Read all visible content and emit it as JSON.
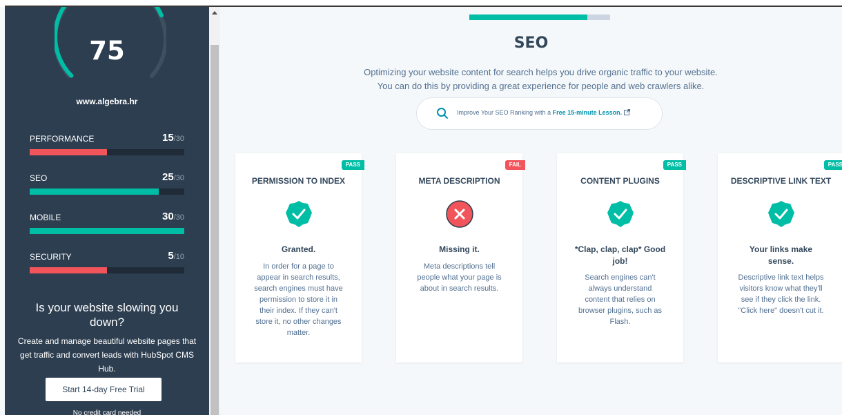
{
  "overall": {
    "score": "75",
    "site": "www.algebra.hr",
    "fraction": 0.75
  },
  "metrics": [
    {
      "label": "PERFORMANCE",
      "score": "15",
      "max": "/30",
      "fraction": 0.5,
      "color": "#f2545b"
    },
    {
      "label": "SEO",
      "score": "25",
      "max": "/30",
      "fraction": 0.833,
      "color": "#00bda5"
    },
    {
      "label": "MOBILE",
      "score": "30",
      "max": "/30",
      "fraction": 1.0,
      "color": "#00bda5"
    },
    {
      "label": "SECURITY",
      "score": "5",
      "max": "/10",
      "fraction": 0.5,
      "color": "#f2545b"
    }
  ],
  "promo": {
    "title": "Is your website slowing you down?",
    "text": "Create and manage beautiful website pages that get traffic and convert leads with HubSpot CMS Hub.",
    "button": "Start 14-day Free Trial",
    "note": "No credit card needed"
  },
  "section": {
    "progress": 0.84,
    "title": "SEO",
    "subtitle_line1": "Optimizing your website content for search helps you drive organic traffic to your website.",
    "subtitle_line2": "You can do this by providing a great experience for people and web crawlers alike.",
    "lesson_prefix": "Improve Your SEO Ranking with a ",
    "lesson_link": "Free 15-minute Lesson."
  },
  "cards": [
    {
      "title": "PERMISSION TO INDEX",
      "badge": "PASS",
      "icon": "check-circle-icon",
      "status": "Granted.",
      "desc": "In order for a page to appear in search results, search engines must have permission to store it in their index. If they can't store it, no other changes matter."
    },
    {
      "title": "META DESCRIPTION",
      "badge": "FAIL",
      "icon": "x-circle-icon",
      "status": "Missing it.",
      "desc": "Meta descriptions tell people what your page is about in search results."
    },
    {
      "title": "CONTENT PLUGINS",
      "badge": "PASS",
      "icon": "check-circle-icon",
      "status": "*Clap, clap, clap* Good job!",
      "desc": "Search engines can't always understand content that relies on browser plugins, such as Flash."
    },
    {
      "title": "DESCRIPTIVE LINK TEXT",
      "badge": "PASS",
      "icon": "check-circle-icon",
      "status": "Your links make sense.",
      "desc": "Descriptive link text helps visitors know what they'll see if they click the link. \"Click here\" doesn't cut it."
    }
  ],
  "colors": {
    "sidebar": "#2d3e50",
    "teal": "#00bda5",
    "red": "#f2545b",
    "text": "#33475b"
  }
}
